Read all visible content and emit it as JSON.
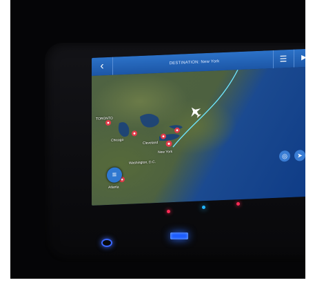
{
  "header": {
    "back_icon": "chevron-left-icon",
    "title": "DESTINATION: New York",
    "list_icon": "list-icon",
    "play_icon": "play-icon"
  },
  "map": {
    "labels": [
      "TORONTO",
      "Chicago",
      "Cleveland",
      "New York",
      "Washington, D.C.",
      "Atlanta"
    ]
  },
  "controls": {
    "menu_icon": "hamburger-icon",
    "locate_icon": "locate-icon",
    "compass_icon": "compass-icon"
  },
  "colors": {
    "header_blue": "#2c72c8",
    "route_cyan": "#6fe6ff",
    "pin_red": "#e23b4a",
    "led_red": "#ff2a55",
    "led_blue": "#22b4ff"
  }
}
